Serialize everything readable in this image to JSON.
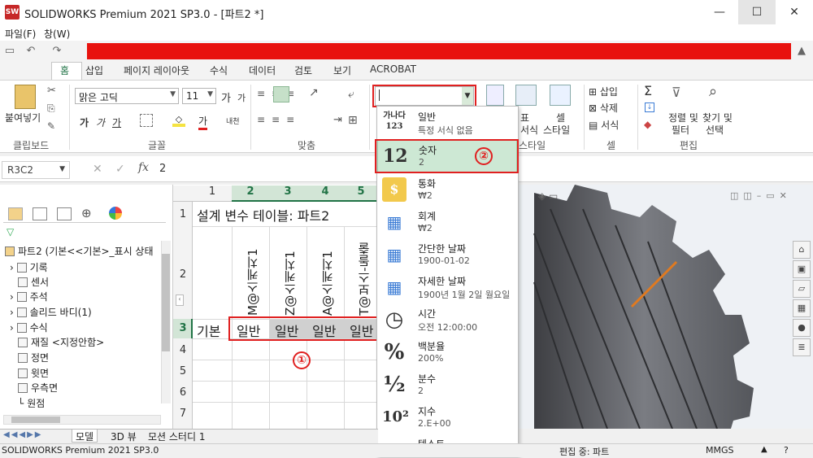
{
  "window": {
    "title": "SOLIDWORKS Premium 2021 SP3.0 - [파트2 *]",
    "minimize": "—",
    "maximize": "☐",
    "close": "✕"
  },
  "menu": [
    "파일(F)",
    "창(W)"
  ],
  "ribbon_tabs": [
    "홈",
    "삽입",
    "페이지 레이아웃",
    "수식",
    "데이터",
    "검토",
    "보기",
    "ACROBAT"
  ],
  "clipboard": {
    "paste": "붙여넣기",
    "group": "클립보드"
  },
  "font": {
    "name": "맑은 고딕",
    "size": "11",
    "grow": "가",
    "shrink": "가",
    "bold": "가",
    "italic": "가",
    "underline": "가",
    "wrap": "내천",
    "color_a": "가",
    "group": "글꼴"
  },
  "align": {
    "group": "맞춤"
  },
  "number_format_box": {
    "value": ""
  },
  "style": {
    "table": "표",
    "table2": "서식",
    "cell": "셀",
    "cell2": "스타일",
    "group": "스타일"
  },
  "cells": {
    "insert": "삽입",
    "delete": "삭제",
    "format": "서식",
    "group": "셀"
  },
  "edit": {
    "sum": "Σ",
    "sort": "정렬 및",
    "sort2": "필터",
    "find": "찾기 및",
    "find2": "선택",
    "group": "편집"
  },
  "formula_bar": {
    "name_box": "R3C2",
    "fx": "fx",
    "content": "2"
  },
  "tree": {
    "root": "파트2 (기본<<기본>_표시 상태",
    "items": [
      "기록",
      "센서",
      "주석",
      "솔리드 바디(1)",
      "수식",
      "재질 <지정안함>",
      "정면",
      "윗면",
      "우측면",
      "원점"
    ]
  },
  "sheet": {
    "col_headers": [
      "1",
      "2",
      "3",
      "4",
      "5"
    ],
    "row_headers": [
      "1",
      "2",
      "3",
      "4",
      "5",
      "6",
      "7"
    ],
    "title": "설계 변수 테이블: 파트2",
    "vertical_headers": [
      "M@스케치1",
      "Z@스케치1",
      "A@스케치1",
      "T@보스-돌출"
    ],
    "row3_label": "기본",
    "row3_values": [
      "일반",
      "일반",
      "일반",
      "일반"
    ]
  },
  "dropdown": [
    {
      "icon": "가나다\n123",
      "name": "일반",
      "sample": "특정 서식 없음"
    },
    {
      "icon": "12",
      "name": "숫자",
      "sample": "2"
    },
    {
      "icon": "$",
      "name": "통화",
      "sample": "₩2"
    },
    {
      "icon": "▦",
      "name": "회계",
      "sample": " ₩2"
    },
    {
      "icon": "▦",
      "name": "간단한 날짜",
      "sample": "1900-01-02"
    },
    {
      "icon": "▦",
      "name": "자세한 날짜",
      "sample": "1900년 1월 2일 월요일"
    },
    {
      "icon": "◷",
      "name": "시간",
      "sample": "오전 12:00:00"
    },
    {
      "icon": "%",
      "name": "백분율",
      "sample": "200%"
    },
    {
      "icon": "½",
      "name": "분수",
      "sample": "2"
    },
    {
      "icon": "10²",
      "name": "지수",
      "sample": "2.E+00"
    },
    {
      "icon": "가나다",
      "name": "텍스트",
      "sample": ""
    }
  ],
  "annotations": {
    "one": "①",
    "two": "②"
  },
  "bottom_tabs": [
    "모델",
    "3D 뷰",
    "모션 스터디 1"
  ],
  "status": {
    "left": "SOLIDWORKS Premium 2021 SP3.0",
    "mid": "편집 중: 파트",
    "units": "MMGS"
  },
  "colors": {
    "accent_green": "#217346",
    "red": "#e02020",
    "gear": "#5f6064"
  }
}
